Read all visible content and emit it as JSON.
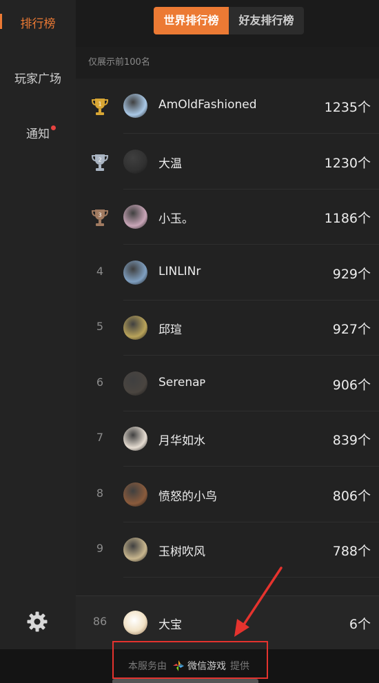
{
  "sidebar": {
    "items": [
      {
        "label": "排行榜",
        "active": true
      },
      {
        "label": "玩家广场",
        "active": false
      },
      {
        "label": "通知",
        "active": false,
        "has_dot": true
      }
    ],
    "settings_icon": "gear-icon"
  },
  "tabs": [
    {
      "label": "世界排行榜",
      "active": true
    },
    {
      "label": "好友排行榜",
      "active": false
    }
  ],
  "notice": "仅展示前100名",
  "ranking": [
    {
      "rank": "1",
      "trophy": "gold",
      "name": "AmOldFashioned",
      "score": "1235个",
      "avatar_color": "#a9c8e6"
    },
    {
      "rank": "2",
      "trophy": "silver",
      "name": "大温",
      "score": "1230个",
      "avatar_color": "#303030"
    },
    {
      "rank": "3",
      "trophy": "bronze",
      "name": "小玉。",
      "score": "1186个",
      "avatar_color": "#c9a6b8"
    },
    {
      "rank": "4",
      "name": "LINLINr",
      "score": "929个",
      "avatar_color": "#7f9fc0"
    },
    {
      "rank": "5",
      "name": "邱瑄",
      "score": "927个",
      "avatar_color": "#b9a35a"
    },
    {
      "rank": "6",
      "name": "Serenaᴘ",
      "score": "906个",
      "avatar_color": "#4a4540"
    },
    {
      "rank": "7",
      "name": "月华如水",
      "score": "839个",
      "avatar_color": "#e6ddd2"
    },
    {
      "rank": "8",
      "name": "愤怒的小鸟",
      "score": "806个",
      "avatar_color": "#8a5b3c"
    },
    {
      "rank": "9",
      "name": "玉树吹风",
      "score": "788个",
      "avatar_color": "#c8b68e"
    }
  ],
  "my_rank": {
    "rank": "86",
    "name": "大宝",
    "score": "6个",
    "avatar_color": "#f1e2c6"
  },
  "footer": {
    "prefix": "本服务由",
    "brand": "微信游戏",
    "suffix": "提供"
  },
  "colors": {
    "accent": "#ec7a34",
    "annotation": "#e5332e"
  }
}
